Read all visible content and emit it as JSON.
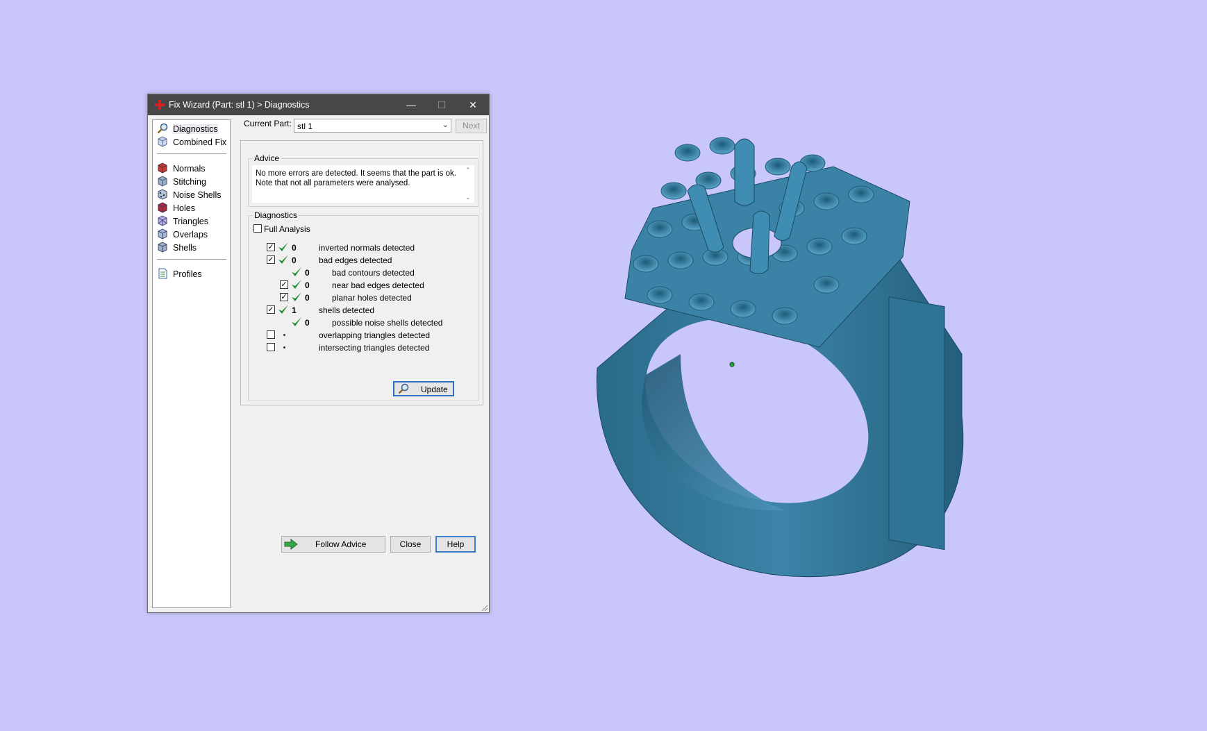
{
  "window": {
    "title": "Fix Wizard (Part: stl 1) > Diagnostics",
    "controls": {
      "minimize": "—",
      "maximize": "☐",
      "close": "✕"
    }
  },
  "sidebar": {
    "items": [
      {
        "label": "Diagnostics",
        "icon": "magnifier-icon",
        "selected": true
      },
      {
        "label": "Combined Fix",
        "icon": "cube-icon"
      },
      {
        "label": "Normals",
        "icon": "normals-cube-icon"
      },
      {
        "label": "Stitching",
        "icon": "stitching-cube-icon"
      },
      {
        "label": "Noise Shells",
        "icon": "noise-shells-icon"
      },
      {
        "label": "Holes",
        "icon": "holes-cube-icon"
      },
      {
        "label": "Triangles",
        "icon": "triangles-cube-icon"
      },
      {
        "label": "Overlaps",
        "icon": "overlaps-cube-icon"
      },
      {
        "label": "Shells",
        "icon": "shells-cube-icon"
      },
      {
        "label": "Profiles",
        "icon": "document-icon"
      }
    ]
  },
  "toolbar": {
    "current_part_label": "Current Part:",
    "current_part_value": "stl 1",
    "next_label": "Next"
  },
  "advice": {
    "legend": "Advice",
    "line1": "No more errors are detected. It seems that the part is ok.",
    "line2": "Note that not all parameters were analysed."
  },
  "diagnostics": {
    "legend": "Diagnostics",
    "full_analysis_label": "Full Analysis",
    "full_analysis_checked": false,
    "rows": [
      {
        "checkbox": true,
        "checked": true,
        "status": "ok",
        "count": "0",
        "label": "inverted normals detected",
        "indent": 0
      },
      {
        "checkbox": true,
        "checked": true,
        "status": "ok",
        "count": "0",
        "label": "bad edges detected",
        "indent": 0
      },
      {
        "checkbox": false,
        "status": "ok",
        "count": "0",
        "label": "bad contours detected",
        "indent": 1
      },
      {
        "checkbox": true,
        "checked": true,
        "status": "ok",
        "count": "0",
        "label": "near bad edges detected",
        "indent": 1
      },
      {
        "checkbox": true,
        "checked": true,
        "status": "ok",
        "count": "0",
        "label": "planar holes detected",
        "indent": 1
      },
      {
        "checkbox": true,
        "checked": true,
        "status": "ok",
        "count": "1",
        "label": "shells detected",
        "indent": 0
      },
      {
        "checkbox": false,
        "status": "ok",
        "count": "0",
        "label": "possible noise shells detected",
        "indent": 1
      },
      {
        "checkbox": true,
        "checked": false,
        "status": "none",
        "count": "",
        "label": "overlapping triangles detected",
        "indent": 0
      },
      {
        "checkbox": true,
        "checked": false,
        "status": "none",
        "count": "",
        "label": "intersecting triangles detected",
        "indent": 0
      }
    ],
    "update_label": "Update"
  },
  "buttons": {
    "follow_advice": "Follow Advice",
    "close": "Close",
    "help": "Help"
  },
  "colors": {
    "viewport_bg": "#c8c6fb",
    "titlebar_bg": "#474747",
    "ok_check": "#1f8a2b",
    "model": "#3b7d9e"
  },
  "viewport": {
    "model": "ring-model"
  }
}
